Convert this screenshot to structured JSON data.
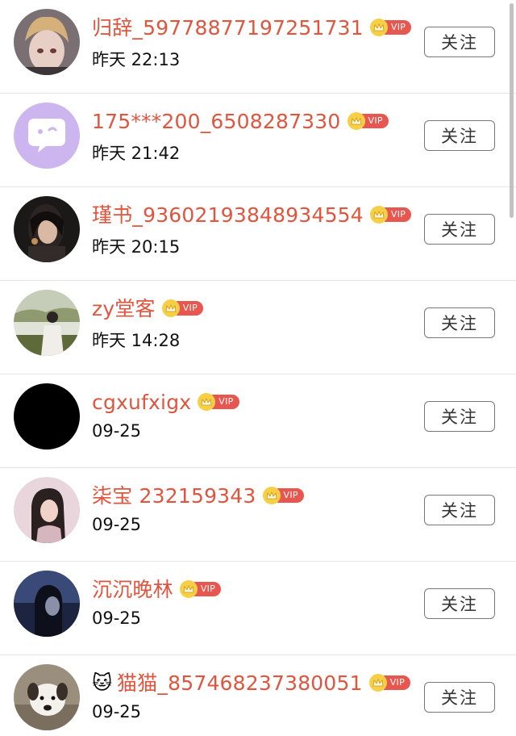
{
  "follow_label": "关注",
  "vip_label": "VIP",
  "colors": {
    "username": "#e0553e",
    "vip_tag": "#e8574f",
    "crown": "#f6cf45"
  },
  "users": [
    {
      "name": "归辞_59778877197251731",
      "time": "昨天 22:13",
      "avatar": "anime-girl-avatar"
    },
    {
      "name": "175***200_6508287330",
      "time": "昨天 21:42",
      "avatar": "chat-bubble-default-avatar"
    },
    {
      "name": "瑾书_93602193848934554",
      "time": "昨天 20:15",
      "avatar": "girl-dark-photo-avatar"
    },
    {
      "name": "zy堂客",
      "time": "昨天 14:28",
      "avatar": "girl-outdoor-photo-avatar"
    },
    {
      "name": "cgxufxigx",
      "time": "09-25",
      "avatar": "black-avatar"
    },
    {
      "name": "柒宝 232159343",
      "time": "09-25",
      "avatar": "girl-pink-photo-avatar"
    },
    {
      "name": "沉沉晚林",
      "time": "09-25",
      "avatar": "girl-blue-photo-avatar"
    },
    {
      "name": "猫猫_857468237380051",
      "time": "09-25",
      "avatar": "dog-photo-avatar",
      "emoji": "🐱"
    }
  ]
}
